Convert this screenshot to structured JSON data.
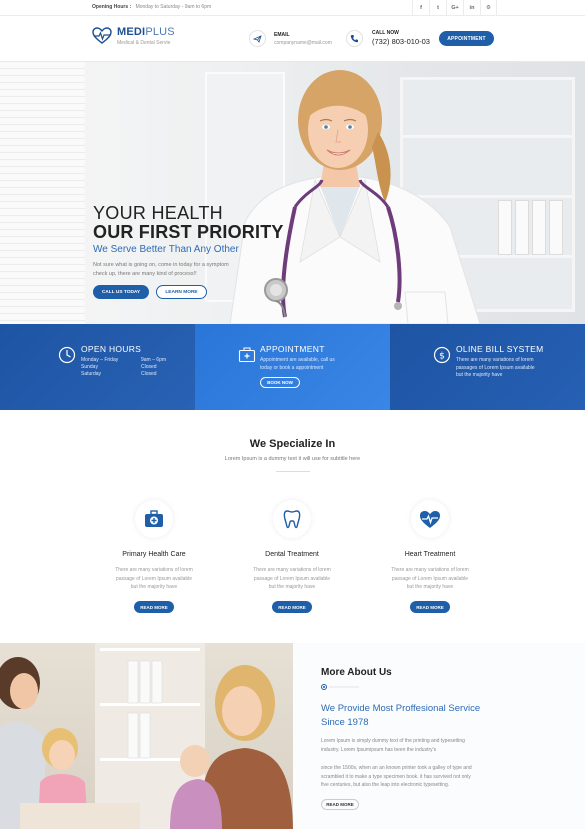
{
  "topbar": {
    "hours_label": "Opening Hours :",
    "hours_value": "Monday to Saturday - 9am to 6pm",
    "social_icons": [
      "facebook-icon",
      "twitter-icon",
      "google-plus-icon",
      "linkedin-icon",
      "settings-icon"
    ],
    "social_glyphs": [
      "f",
      "t",
      "G+",
      "in",
      "⚙"
    ]
  },
  "header": {
    "logo_bold": "MEDI",
    "logo_thin": "PLUS",
    "logo_sub": "Medical & Dental Servie",
    "email_label": "EMAIL",
    "email_value": "companyname@mail.com",
    "call_label": "CALL NOW",
    "call_value": "(732) 803-010-03",
    "appointment_button": "APPOINTMENT"
  },
  "hero": {
    "title_line1": "YOUR HEALTH",
    "title_line2": "OUR FIRST PRIORITY",
    "subtitle": "We Serve Better Than Any Other",
    "desc_line1": "Not sure what is going on, come in today for a symptom",
    "desc_line2": "check up, there are many kind of process!!",
    "btn_call": "CALL US TODAY",
    "btn_learn": "LEARN MORE"
  },
  "info_band": {
    "hours": {
      "title": "OPEN HOURS",
      "rows": [
        {
          "day": "Monday – Friday",
          "time": "9am – 6pm"
        },
        {
          "day": "Sunday",
          "time": "Closed"
        },
        {
          "day": "Saturday",
          "time": "Closed"
        }
      ]
    },
    "appointment": {
      "title": "APPOINTMENT",
      "line1": "Appointment are available, call us",
      "line2": "today or book a appointment",
      "button": "BOOK NOW"
    },
    "bill": {
      "title": "OLINE BILL SYSTEM",
      "line1": "There are many variations of lorem",
      "line2": "passages of Lorem Ipsum available",
      "line3": "but the majority have"
    }
  },
  "specialize": {
    "title": "We Specialize In",
    "subtitle": "Lorem Ipsum is a dummy text it will use for subtitle here",
    "cards": [
      {
        "title": "Primary Health Care",
        "line1": "There are many variations of lorem",
        "line2": "passage of Lorem Ipsum available",
        "line3": "but the majority have",
        "button": "READ MORE",
        "icon": "medical-kit-icon"
      },
      {
        "title": "Dental Treatment",
        "line1": "There are many variations of lorem",
        "line2": "passage of Lorem Ipsum available",
        "line3": "but the majority have",
        "button": "READ MORE",
        "icon": "tooth-icon"
      },
      {
        "title": "Heart Treatment",
        "line1": "There are many variations of lorem",
        "line2": "passage of Lorem Ipsum available",
        "line3": "but the majority have",
        "button": "READ MORE",
        "icon": "heartbeat-icon"
      }
    ]
  },
  "about": {
    "title": "More About Us",
    "heading_line1": "We Provide Most Proffesional Service",
    "heading_line2": "Since 1978",
    "p1_line1": "Lorem Ipsum is simply dummy text of the printing and typesetting",
    "p1_line2": "industry. Lorem Ipsumipsum has been the industry's",
    "p2_line1": "since the 1500s, when an an known printer took a galley of type and",
    "p2_line2": "scrambled it to make a type specimen book. it has survived not only",
    "p2_line3": "five centuries, but also the leap into electronic typesetting.",
    "button": "READ MORE"
  },
  "colors": {
    "primary": "#1f5ea8",
    "accent_blue": "#2d6bb6",
    "band_light": "#3a86e6"
  }
}
